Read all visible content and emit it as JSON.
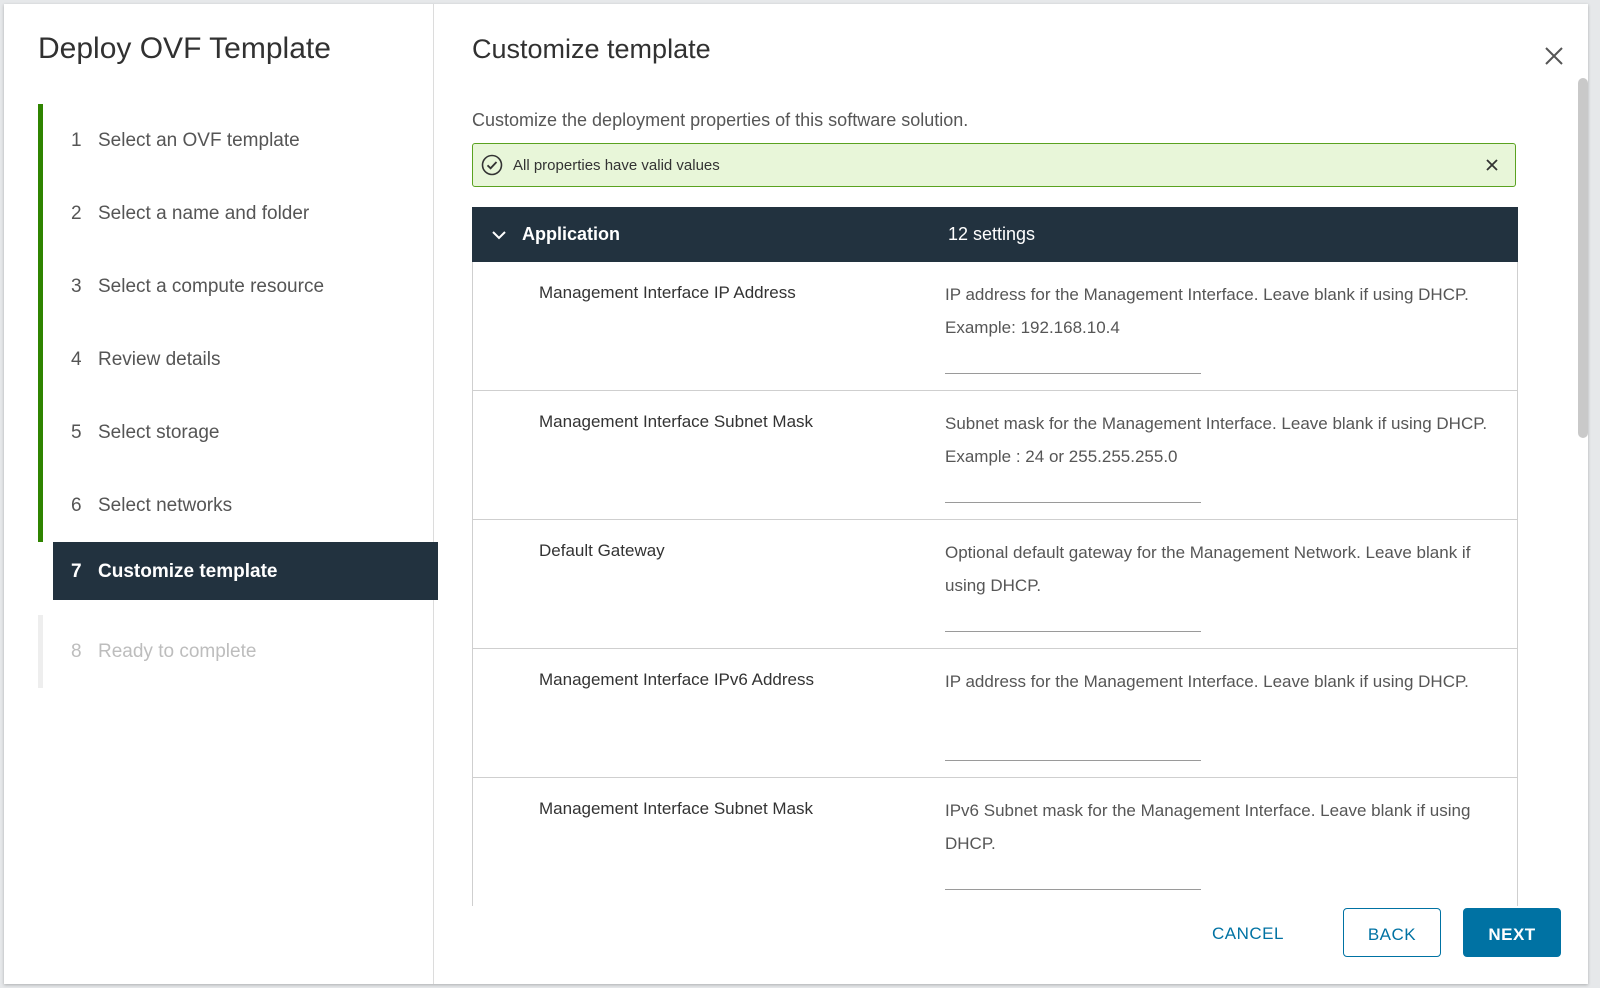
{
  "wizard": {
    "title": "Deploy OVF Template",
    "steps": [
      {
        "num": "1",
        "label": "Select an OVF template"
      },
      {
        "num": "2",
        "label": "Select a name and folder"
      },
      {
        "num": "3",
        "label": "Select a compute resource"
      },
      {
        "num": "4",
        "label": "Review details"
      },
      {
        "num": "5",
        "label": "Select storage"
      },
      {
        "num": "6",
        "label": "Select networks"
      },
      {
        "num": "7",
        "label": "Customize template"
      },
      {
        "num": "8",
        "label": "Ready to complete"
      }
    ],
    "current_step": "7"
  },
  "page": {
    "title": "Customize template",
    "subtitle": "Customize the deployment properties of this software solution."
  },
  "alert": {
    "message": "All properties have valid values",
    "status_color": "#5aa220"
  },
  "group": {
    "name": "Application",
    "count": "12 settings"
  },
  "properties": [
    {
      "name": "Management Interface IP Address",
      "description": "IP address for the Management Interface. Leave blank if using DHCP. Example: 192.168.10.4",
      "value": ""
    },
    {
      "name": "Management Interface Subnet Mask",
      "description": "Subnet mask for the Management Interface. Leave blank if using DHCP. Example : 24 or 255.255.255.0",
      "value": ""
    },
    {
      "name": "Default Gateway",
      "description": "Optional default gateway for the Management Network. Leave blank if using DHCP.",
      "value": ""
    },
    {
      "name": "Management Interface IPv6 Address",
      "description": "IP address for the Management Interface. Leave blank if using DHCP.",
      "value": ""
    },
    {
      "name": "Management Interface Subnet Mask",
      "description": "IPv6 Subnet mask for the Management Interface. Leave blank if using DHCP.",
      "value": ""
    }
  ],
  "footer": {
    "cancel_label": "CANCEL",
    "back_label": "BACK",
    "next_label": "NEXT"
  },
  "colors": {
    "nav_active_bg": "#22323f",
    "progress_green": "#2f8400",
    "primary_blue": "#0072a3"
  },
  "icons": {
    "close": "close-icon",
    "alert_status": "check-circle-icon",
    "alert_dismiss": "close-icon",
    "group_toggle": "chevron-down-icon"
  }
}
